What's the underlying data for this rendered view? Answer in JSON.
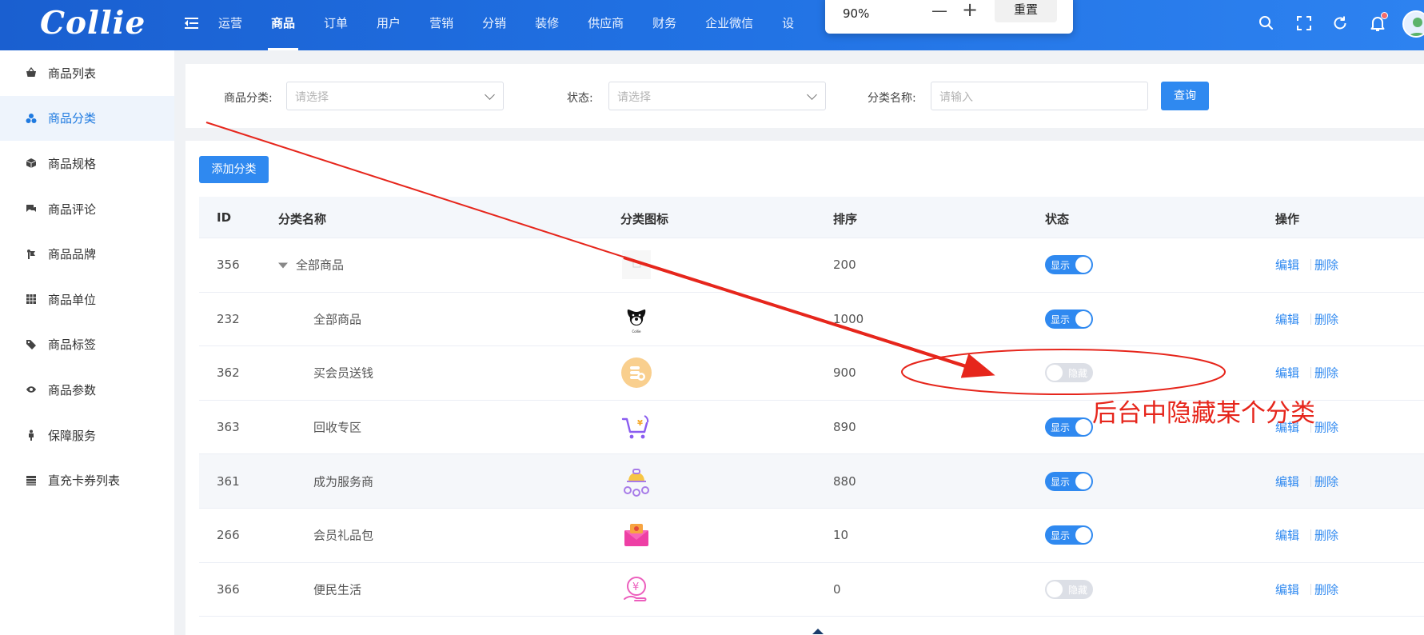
{
  "header": {
    "logo": "Collie",
    "nav": [
      "运营",
      "商品",
      "订单",
      "用户",
      "营销",
      "分销",
      "装修",
      "供应商",
      "财务",
      "企业微信",
      "设"
    ],
    "active_nav": "商品"
  },
  "zoom_popup": {
    "value": "90%",
    "minus": "—",
    "plus": "+",
    "reset": "重置"
  },
  "sidebar": {
    "items": [
      {
        "label": "商品列表",
        "icon": "basket-icon"
      },
      {
        "label": "商品分类",
        "icon": "category-icon",
        "active": true
      },
      {
        "label": "商品规格",
        "icon": "cube-icon"
      },
      {
        "label": "商品评论",
        "icon": "comment-icon"
      },
      {
        "label": "商品品牌",
        "icon": "brand-icon"
      },
      {
        "label": "商品单位",
        "icon": "grid-icon"
      },
      {
        "label": "商品标签",
        "icon": "tag-icon"
      },
      {
        "label": "商品参数",
        "icon": "eye-icon"
      },
      {
        "label": "保障服务",
        "icon": "person-icon"
      },
      {
        "label": "直充卡券列表",
        "icon": "list-icon"
      }
    ]
  },
  "filters": {
    "category_label": "商品分类:",
    "category_placeholder": "请选择",
    "status_label": "状态:",
    "status_placeholder": "请选择",
    "name_label": "分类名称:",
    "name_placeholder": "请输入",
    "query_button": "查询"
  },
  "table": {
    "add_button": "添加分类",
    "columns": [
      "ID",
      "分类名称",
      "分类图标",
      "排序",
      "状态",
      "操作"
    ],
    "rows": [
      {
        "id": "356",
        "name": "全部商品",
        "icon": "placeholder-image-icon",
        "sort": "200",
        "status": "显示",
        "on": true,
        "expandable": true
      },
      {
        "id": "232",
        "name": "全部商品",
        "icon": "dog-logo-icon",
        "sort": "1000",
        "status": "显示",
        "on": true
      },
      {
        "id": "362",
        "name": "买会员送钱",
        "icon": "coin-stack-icon",
        "sort": "900",
        "status": "隐藏",
        "on": false
      },
      {
        "id": "363",
        "name": "回收专区",
        "icon": "recycle-cart-icon",
        "sort": "890",
        "status": "显示",
        "on": true
      },
      {
        "id": "361",
        "name": "成为服务商",
        "icon": "service-bag-icon",
        "sort": "880",
        "status": "显示",
        "on": true
      },
      {
        "id": "266",
        "name": "会员礼品包",
        "icon": "gift-envelope-icon",
        "sort": "10",
        "status": "显示",
        "on": true
      },
      {
        "id": "366",
        "name": "便民生活",
        "icon": "yuan-hand-icon",
        "sort": "0",
        "status": "隐藏",
        "on": false
      }
    ],
    "edit_label": "编辑",
    "delete_label": "删除"
  },
  "annotation": {
    "text": "后台中隐藏某个分类",
    "color": "#e6261c"
  }
}
